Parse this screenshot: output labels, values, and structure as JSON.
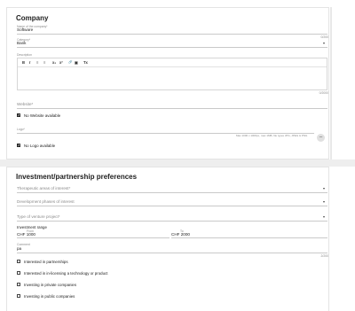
{
  "company": {
    "section_title": "Company",
    "name": {
      "label": "Name of the company*",
      "value": "Software",
      "counter": "0/200"
    },
    "category": {
      "label": "Category*",
      "value": "Bank"
    },
    "description": {
      "label": "Description",
      "toolbar": [
        "B",
        "I",
        "≡",
        "≡",
        "x₂",
        "x²",
        "🔗",
        "▣",
        "Tx"
      ],
      "counter": "0/2000"
    },
    "website": {
      "label": "Website*",
      "value": "",
      "no_website_label": "No Website available",
      "no_website_checked": true
    },
    "logo": {
      "label": "Logo*",
      "hint": "Max 1000 x 1000px, max 1MB, file types JPG, JPEG & PNG",
      "no_logo_label": "No Logo available",
      "no_logo_checked": true
    }
  },
  "investment": {
    "section_title": "Investment/partnership preferences",
    "therapeutic_areas": {
      "placeholder": "Therapeutic areas of interest*"
    },
    "development_phases": {
      "placeholder": "Development phases of interest"
    },
    "venture_type": {
      "placeholder": "Type of venture project*"
    },
    "range": {
      "label": "Investment range",
      "from_label": "From",
      "from_value": "CHF 1000",
      "to_label": "To",
      "to_value": "CHF 2000"
    },
    "comment": {
      "label": "Comment",
      "value": "pa",
      "counter": "2/200"
    },
    "options": [
      {
        "label": "Interested in partnerships",
        "checked": false
      },
      {
        "label": "Interested in in-licensing a technology or product",
        "checked": false
      },
      {
        "label": "Investing in private companies",
        "checked": false
      },
      {
        "label": "Investing in public companies",
        "checked": false
      }
    ]
  }
}
